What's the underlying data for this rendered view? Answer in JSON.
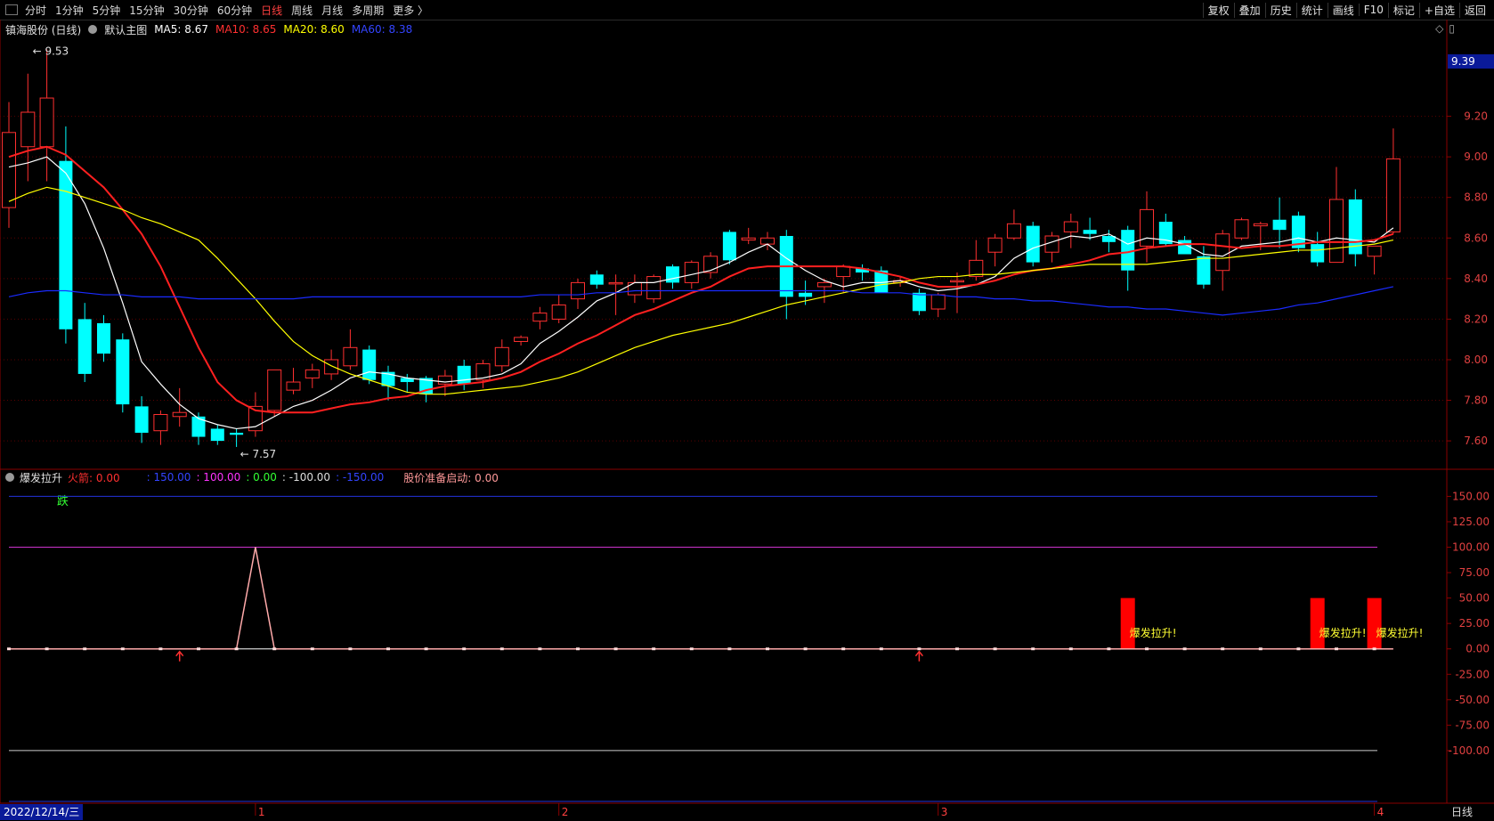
{
  "toolbar": {
    "periods": [
      "分时",
      "1分钟",
      "5分钟",
      "15分钟",
      "30分钟",
      "60分钟",
      "日线",
      "周线",
      "月线",
      "多周期",
      "更多 〉"
    ],
    "active_period": "日线",
    "tools": [
      "复权",
      "叠加",
      "历史",
      "统计",
      "画线",
      "F10",
      "标记",
      "+自选",
      "返回"
    ]
  },
  "main_legend": {
    "stock": "镇海股份 (日线)",
    "indicator": "默认主图",
    "ma5": "MA5: 8.67",
    "ma10": "MA10: 8.65",
    "ma20": "MA20: 8.60",
    "ma60": "MA60: 8.38"
  },
  "sub_legend": {
    "name": "爆发拉升",
    "huojian": "火箭: 0.00",
    "l150": ": 150.00",
    "l100": ": 100.00",
    "l0": ": 0.00",
    "lm100": ": -100.00",
    "lm150": ": -150.00",
    "ready": "股价准备启动: 0.00"
  },
  "price_tag": "9.39",
  "date_label": "2022/12/14/三",
  "period_label": "日线",
  "colors": {
    "up": "#ff3030",
    "down": "#00ffff",
    "ma5": "#ffffff",
    "ma10": "#ff2020",
    "ma20": "#ffff00",
    "ma60": "#1a2bff",
    "grid": "#5a0000"
  },
  "chart_data": [
    {
      "type": "candlestick",
      "y_axis_ticks": [
        "7.60",
        "7.80",
        "8.00",
        "8.20",
        "8.40",
        "8.60",
        "8.80",
        "9.00",
        "9.20"
      ],
      "ylim": [
        7.46,
        9.58
      ],
      "annotations": [
        {
          "text": "9.53",
          "candle": 2,
          "value": 9.53
        },
        {
          "text": "7.57",
          "candle": 12,
          "value": 7.57
        },
        {
          "text": "跌",
          "candle": 3,
          "value": 7.46
        }
      ],
      "x_markers": [
        "1",
        "2",
        "3",
        "4"
      ],
      "x_marker_candles": [
        13,
        29,
        49,
        72
      ],
      "candles": [
        {
          "o": 8.75,
          "h": 9.27,
          "l": 8.65,
          "c": 9.12
        },
        {
          "o": 9.05,
          "h": 9.41,
          "l": 8.88,
          "c": 9.22
        },
        {
          "o": 9.05,
          "h": 9.53,
          "l": 8.88,
          "c": 9.29
        },
        {
          "o": 8.98,
          "h": 9.15,
          "l": 8.08,
          "c": 8.15
        },
        {
          "o": 8.2,
          "h": 8.28,
          "l": 7.89,
          "c": 7.93
        },
        {
          "o": 8.18,
          "h": 8.22,
          "l": 7.99,
          "c": 8.03
        },
        {
          "o": 8.1,
          "h": 8.13,
          "l": 7.74,
          "c": 7.78
        },
        {
          "o": 7.77,
          "h": 7.82,
          "l": 7.59,
          "c": 7.64
        },
        {
          "o": 7.65,
          "h": 7.75,
          "l": 7.58,
          "c": 7.73
        },
        {
          "o": 7.72,
          "h": 7.86,
          "l": 7.67,
          "c": 7.74
        },
        {
          "o": 7.72,
          "h": 7.74,
          "l": 7.58,
          "c": 7.62
        },
        {
          "o": 7.66,
          "h": 7.68,
          "l": 7.58,
          "c": 7.6
        },
        {
          "o": 7.64,
          "h": 7.66,
          "l": 7.57,
          "c": 7.63
        },
        {
          "o": 7.65,
          "h": 7.84,
          "l": 7.62,
          "c": 7.77
        },
        {
          "o": 7.75,
          "h": 7.95,
          "l": 7.72,
          "c": 7.95
        },
        {
          "o": 7.85,
          "h": 7.96,
          "l": 7.83,
          "c": 7.89
        },
        {
          "o": 7.91,
          "h": 7.98,
          "l": 7.86,
          "c": 7.95
        },
        {
          "o": 7.93,
          "h": 8.05,
          "l": 7.9,
          "c": 8.0
        },
        {
          "o": 7.97,
          "h": 8.15,
          "l": 7.95,
          "c": 8.06
        },
        {
          "o": 8.05,
          "h": 8.07,
          "l": 7.88,
          "c": 7.9
        },
        {
          "o": 7.94,
          "h": 7.97,
          "l": 7.8,
          "c": 7.87
        },
        {
          "o": 7.91,
          "h": 7.93,
          "l": 7.84,
          "c": 7.89
        },
        {
          "o": 7.91,
          "h": 7.92,
          "l": 7.79,
          "c": 7.83
        },
        {
          "o": 7.88,
          "h": 7.95,
          "l": 7.82,
          "c": 7.92
        },
        {
          "o": 7.97,
          "h": 8.0,
          "l": 7.85,
          "c": 7.88
        },
        {
          "o": 7.9,
          "h": 8.0,
          "l": 7.86,
          "c": 7.98
        },
        {
          "o": 7.97,
          "h": 8.1,
          "l": 7.94,
          "c": 8.06
        },
        {
          "o": 8.09,
          "h": 8.12,
          "l": 8.07,
          "c": 8.11
        },
        {
          "o": 8.19,
          "h": 8.26,
          "l": 8.15,
          "c": 8.23
        },
        {
          "o": 8.2,
          "h": 8.32,
          "l": 8.18,
          "c": 8.27
        },
        {
          "o": 8.3,
          "h": 8.4,
          "l": 8.25,
          "c": 8.38
        },
        {
          "o": 8.42,
          "h": 8.44,
          "l": 8.35,
          "c": 8.37
        },
        {
          "o": 8.38,
          "h": 8.42,
          "l": 8.22,
          "c": 8.38
        },
        {
          "o": 8.32,
          "h": 8.42,
          "l": 8.28,
          "c": 8.38
        },
        {
          "o": 8.3,
          "h": 8.42,
          "l": 8.28,
          "c": 8.41
        },
        {
          "o": 8.46,
          "h": 8.47,
          "l": 8.35,
          "c": 8.38
        },
        {
          "o": 8.38,
          "h": 8.49,
          "l": 8.35,
          "c": 8.48
        },
        {
          "o": 8.43,
          "h": 8.53,
          "l": 8.4,
          "c": 8.51
        },
        {
          "o": 8.63,
          "h": 8.64,
          "l": 8.47,
          "c": 8.49
        },
        {
          "o": 8.59,
          "h": 8.65,
          "l": 8.57,
          "c": 8.6
        },
        {
          "o": 8.57,
          "h": 8.63,
          "l": 8.54,
          "c": 8.6
        },
        {
          "o": 8.61,
          "h": 8.64,
          "l": 8.2,
          "c": 8.31
        },
        {
          "o": 8.33,
          "h": 8.39,
          "l": 8.27,
          "c": 8.31
        },
        {
          "o": 8.36,
          "h": 8.4,
          "l": 8.28,
          "c": 8.38
        },
        {
          "o": 8.41,
          "h": 8.47,
          "l": 8.33,
          "c": 8.46
        },
        {
          "o": 8.45,
          "h": 8.47,
          "l": 8.39,
          "c": 8.43
        },
        {
          "o": 8.44,
          "h": 8.46,
          "l": 8.34,
          "c": 8.33
        },
        {
          "o": 8.38,
          "h": 8.41,
          "l": 8.36,
          "c": 8.39
        },
        {
          "o": 8.33,
          "h": 8.35,
          "l": 8.22,
          "c": 8.24
        },
        {
          "o": 8.25,
          "h": 8.33,
          "l": 8.21,
          "c": 8.32
        },
        {
          "o": 8.39,
          "h": 8.43,
          "l": 8.23,
          "c": 8.39
        },
        {
          "o": 8.41,
          "h": 8.59,
          "l": 8.39,
          "c": 8.49
        },
        {
          "o": 8.53,
          "h": 8.62,
          "l": 8.46,
          "c": 8.6
        },
        {
          "o": 8.6,
          "h": 8.74,
          "l": 8.59,
          "c": 8.67
        },
        {
          "o": 8.66,
          "h": 8.68,
          "l": 8.46,
          "c": 8.48
        },
        {
          "o": 8.53,
          "h": 8.63,
          "l": 8.48,
          "c": 8.61
        },
        {
          "o": 8.63,
          "h": 8.72,
          "l": 8.55,
          "c": 8.68
        },
        {
          "o": 8.64,
          "h": 8.7,
          "l": 8.59,
          "c": 8.62
        },
        {
          "o": 8.61,
          "h": 8.64,
          "l": 8.53,
          "c": 8.58
        },
        {
          "o": 8.64,
          "h": 8.66,
          "l": 8.34,
          "c": 8.44
        },
        {
          "o": 8.56,
          "h": 8.83,
          "l": 8.48,
          "c": 8.74
        },
        {
          "o": 8.68,
          "h": 8.72,
          "l": 8.56,
          "c": 8.57
        },
        {
          "o": 8.59,
          "h": 8.61,
          "l": 8.53,
          "c": 8.52
        },
        {
          "o": 8.51,
          "h": 8.56,
          "l": 8.35,
          "c": 8.37
        },
        {
          "o": 8.44,
          "h": 8.64,
          "l": 8.34,
          "c": 8.62
        },
        {
          "o": 8.6,
          "h": 8.7,
          "l": 8.59,
          "c": 8.69
        },
        {
          "o": 8.66,
          "h": 8.68,
          "l": 8.54,
          "c": 8.67
        },
        {
          "o": 8.69,
          "h": 8.8,
          "l": 8.55,
          "c": 8.64
        },
        {
          "o": 8.71,
          "h": 8.73,
          "l": 8.53,
          "c": 8.55
        },
        {
          "o": 8.57,
          "h": 8.63,
          "l": 8.46,
          "c": 8.48
        },
        {
          "o": 8.48,
          "h": 8.95,
          "l": 8.48,
          "c": 8.79
        },
        {
          "o": 8.79,
          "h": 8.84,
          "l": 8.46,
          "c": 8.52
        },
        {
          "o": 8.51,
          "h": 8.56,
          "l": 8.42,
          "c": 8.56
        },
        {
          "o": 8.63,
          "h": 9.14,
          "l": 8.62,
          "c": 8.99
        }
      ],
      "series": [
        {
          "name": "MA5",
          "values": [
            8.95,
            8.97,
            9.0,
            8.92,
            8.77,
            8.55,
            8.28,
            7.99,
            7.88,
            7.78,
            7.71,
            7.68,
            7.66,
            7.67,
            7.72,
            7.77,
            7.8,
            7.85,
            7.91,
            7.94,
            7.93,
            7.91,
            7.9,
            7.89,
            7.9,
            7.91,
            7.93,
            7.98,
            8.08,
            8.14,
            8.21,
            8.29,
            8.33,
            8.38,
            8.38,
            8.4,
            8.42,
            8.44,
            8.48,
            8.53,
            8.57,
            8.5,
            8.44,
            8.39,
            8.36,
            8.38,
            8.38,
            8.39,
            8.36,
            8.34,
            8.35,
            8.37,
            8.41,
            8.5,
            8.55,
            8.58,
            8.61,
            8.6,
            8.62,
            8.57,
            8.6,
            8.59,
            8.57,
            8.52,
            8.51,
            8.56,
            8.57,
            8.58,
            8.6,
            8.58,
            8.6,
            8.59,
            8.58,
            8.65
          ]
        },
        {
          "name": "MA10",
          "values": [
            9.0,
            9.03,
            9.05,
            9.01,
            8.93,
            8.85,
            8.74,
            8.62,
            8.46,
            8.26,
            8.06,
            7.89,
            7.8,
            7.75,
            7.74,
            7.74,
            7.74,
            7.76,
            7.78,
            7.79,
            7.81,
            7.82,
            7.85,
            7.87,
            7.88,
            7.89,
            7.91,
            7.94,
            7.99,
            8.03,
            8.08,
            8.12,
            8.17,
            8.22,
            8.25,
            8.29,
            8.33,
            8.36,
            8.41,
            8.45,
            8.46,
            8.46,
            8.46,
            8.46,
            8.46,
            8.45,
            8.43,
            8.41,
            8.38,
            8.36,
            8.36,
            8.37,
            8.39,
            8.42,
            8.44,
            8.45,
            8.47,
            8.49,
            8.52,
            8.53,
            8.55,
            8.56,
            8.57,
            8.57,
            8.56,
            8.55,
            8.56,
            8.56,
            8.57,
            8.58,
            8.58,
            8.58,
            8.59,
            8.62
          ]
        },
        {
          "name": "MA20",
          "values": [
            8.78,
            8.82,
            8.85,
            8.83,
            8.8,
            8.77,
            8.74,
            8.7,
            8.67,
            8.63,
            8.59,
            8.5,
            8.4,
            8.3,
            8.19,
            8.09,
            8.02,
            7.97,
            7.93,
            7.9,
            7.87,
            7.84,
            7.83,
            7.83,
            7.84,
            7.85,
            7.86,
            7.87,
            7.89,
            7.91,
            7.94,
            7.98,
            8.02,
            8.06,
            8.09,
            8.12,
            8.14,
            8.16,
            8.18,
            8.21,
            8.24,
            8.27,
            8.29,
            8.31,
            8.33,
            8.35,
            8.37,
            8.38,
            8.4,
            8.41,
            8.41,
            8.42,
            8.42,
            8.43,
            8.44,
            8.45,
            8.46,
            8.47,
            8.47,
            8.47,
            8.47,
            8.48,
            8.49,
            8.5,
            8.5,
            8.51,
            8.52,
            8.53,
            8.54,
            8.54,
            8.55,
            8.56,
            8.57,
            8.59
          ]
        },
        {
          "name": "MA60",
          "values": [
            8.31,
            8.33,
            8.34,
            8.34,
            8.33,
            8.32,
            8.32,
            8.31,
            8.31,
            8.31,
            8.3,
            8.3,
            8.3,
            8.3,
            8.3,
            8.3,
            8.31,
            8.31,
            8.31,
            8.31,
            8.31,
            8.31,
            8.31,
            8.31,
            8.31,
            8.31,
            8.31,
            8.31,
            8.32,
            8.32,
            8.32,
            8.33,
            8.33,
            8.34,
            8.34,
            8.34,
            8.34,
            8.34,
            8.34,
            8.34,
            8.34,
            8.34,
            8.34,
            8.34,
            8.34,
            8.33,
            8.33,
            8.33,
            8.32,
            8.32,
            8.31,
            8.31,
            8.3,
            8.3,
            8.29,
            8.29,
            8.28,
            8.27,
            8.26,
            8.26,
            8.25,
            8.25,
            8.24,
            8.23,
            8.22,
            8.23,
            8.24,
            8.25,
            8.27,
            8.28,
            8.3,
            8.32,
            8.34,
            8.36
          ]
        }
      ]
    },
    {
      "type": "line",
      "title": "爆发拉升",
      "y_axis_ticks": [
        "150.00",
        "125.00",
        "100.00",
        "75.00",
        "50.00",
        "25.00",
        "0.00",
        "-25.00",
        "-50.00",
        "-75.00",
        "-100.00"
      ],
      "ylim": [
        -150,
        160
      ],
      "reference_lines": [
        150,
        100,
        0,
        -100,
        -150
      ],
      "line_values": [
        0,
        0,
        0,
        0,
        0,
        0,
        0,
        0,
        0,
        0,
        0,
        0,
        0,
        100,
        0,
        0,
        0,
        0,
        0,
        0,
        0,
        0,
        0,
        0,
        0,
        0,
        0,
        0,
        0,
        0,
        0,
        0,
        0,
        0,
        0,
        0,
        0,
        0,
        0,
        0,
        0,
        0,
        0,
        0,
        0,
        0,
        0,
        0,
        0,
        0,
        0,
        0,
        0,
        0,
        0,
        0,
        0,
        0,
        0,
        0,
        0,
        0,
        0,
        0,
        0,
        0,
        0,
        0,
        0,
        0,
        0,
        0,
        0,
        0
      ],
      "arrows": [
        9,
        48
      ],
      "bars": [
        {
          "candle": 59,
          "value": 50
        },
        {
          "candle": 69,
          "value": 50
        },
        {
          "candle": 72,
          "value": 50
        }
      ],
      "bar_label": "爆发拉升!"
    }
  ]
}
